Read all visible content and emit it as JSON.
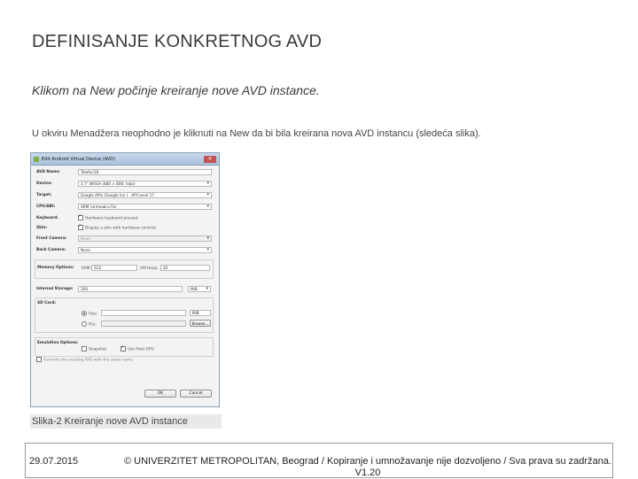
{
  "slide": {
    "title": "DEFINISANJE KONKRETNOG AVD",
    "subtitle": "Klikom na New počinje kreiranje nove AVD instance.",
    "body": "U okviru Menadžera neophodno je kliknuti na New da bi bila kreirana nova AVD instancu (sledeća slika).",
    "caption": "Slika-2 Kreiranje nove AVD instance"
  },
  "dialog": {
    "title": "Edit Android Virtual Device (AVD)",
    "close": "✕",
    "avd_name_label": "AVD Name:",
    "avd_name_value": "Telefon18",
    "device_label": "Device:",
    "device_value": "3.7\" WVGA (480 × 800: hdpi)",
    "target_label": "Target:",
    "target_value": "Google APIs (Google Inc.) - API Level 17",
    "cpu_label": "CPU/ABI:",
    "cpu_value": "ARM (armeabi-v7a)",
    "keyboard_label": "Keyboard:",
    "keyboard_value": "Hardware keyboard present",
    "skin_label": "Skin:",
    "skin_value": "Display a skin with hardware controls",
    "front_camera_label": "Front Camera:",
    "front_camera_value": "None",
    "back_camera_label": "Back Camera:",
    "back_camera_value": "None",
    "memory_label": "Memory Options:",
    "ram_label": "RAM:",
    "ram_value": "512",
    "vm_heap_label": "VM Heap:",
    "vm_heap_value": "32",
    "internal_storage_label": "Internal Storage:",
    "internal_storage_value": "200",
    "internal_storage_unit": "MiB",
    "sd_card_label": "SD Card:",
    "sd_size_label": "Size:",
    "sd_size_unit": "MiB",
    "sd_file_label": "File:",
    "browse_label": "Browse...",
    "emulation_label": "Emulation Options:",
    "snapshot_label": "Snapshot",
    "host_gpu_label": "Use Host GPU",
    "override_label": "Override the existing AVD with the same name",
    "ok_label": "OK",
    "cancel_label": "Cancel"
  },
  "footer": {
    "date": "29.07.2015",
    "copyright": "© UNIVERZITET METROPOLITAN, Beograd / Kopiranje i umnožavanje nije dozvoljeno / Sva prava su zadržana. V1.20"
  }
}
